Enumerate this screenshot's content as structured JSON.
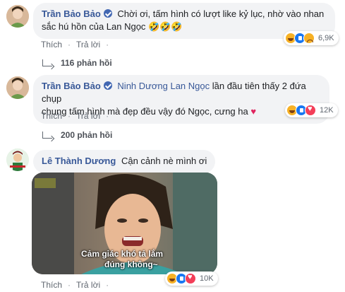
{
  "comments": [
    {
      "author": "Trần Bảo Bảo",
      "text": "Chời ơi, tấm hình có lượt like kỷ lục, nhờ vào nhan sắc hú hồn của Lan Ngọc 🤣🤣🤣",
      "line1": "Chời ơi, tấm hình có lượt like kỷ lục, nhờ vào nhan",
      "line2": "sắc hú hồn của Lan Ngọc 🤣🤣🤣",
      "actions": {
        "like": "Thích",
        "reply": "Trả lời"
      },
      "reaction_count": "6,9K",
      "replies_label": "116 phản hồi"
    },
    {
      "author": "Trần Bảo Bảo",
      "mention": "Ninh Dương Lan Ngọc",
      "line1": "lần đầu tiên thấy 2 đứa chụp",
      "line2": "chung tấm hình mà đẹp đều vậy đó Ngọc, cưng ha",
      "heart": "❤️",
      "actions": {
        "like": "Thích",
        "reply": "Trả lời"
      },
      "reaction_count": "12K",
      "replies_label": "200 phản hồi"
    },
    {
      "author": "Lê Thành Dương",
      "text": "Cận cảnh nè mình ơi",
      "photo_caption_1": "Cảm giác khó tả lắm",
      "photo_caption_2": "đúng không~",
      "actions": {
        "like": "Thích",
        "reply": "Trả lời"
      },
      "reaction_count": "10K"
    }
  ],
  "colors": {
    "name": "#385898",
    "bubble": "#f2f3f5",
    "heart": "#e0245e"
  }
}
